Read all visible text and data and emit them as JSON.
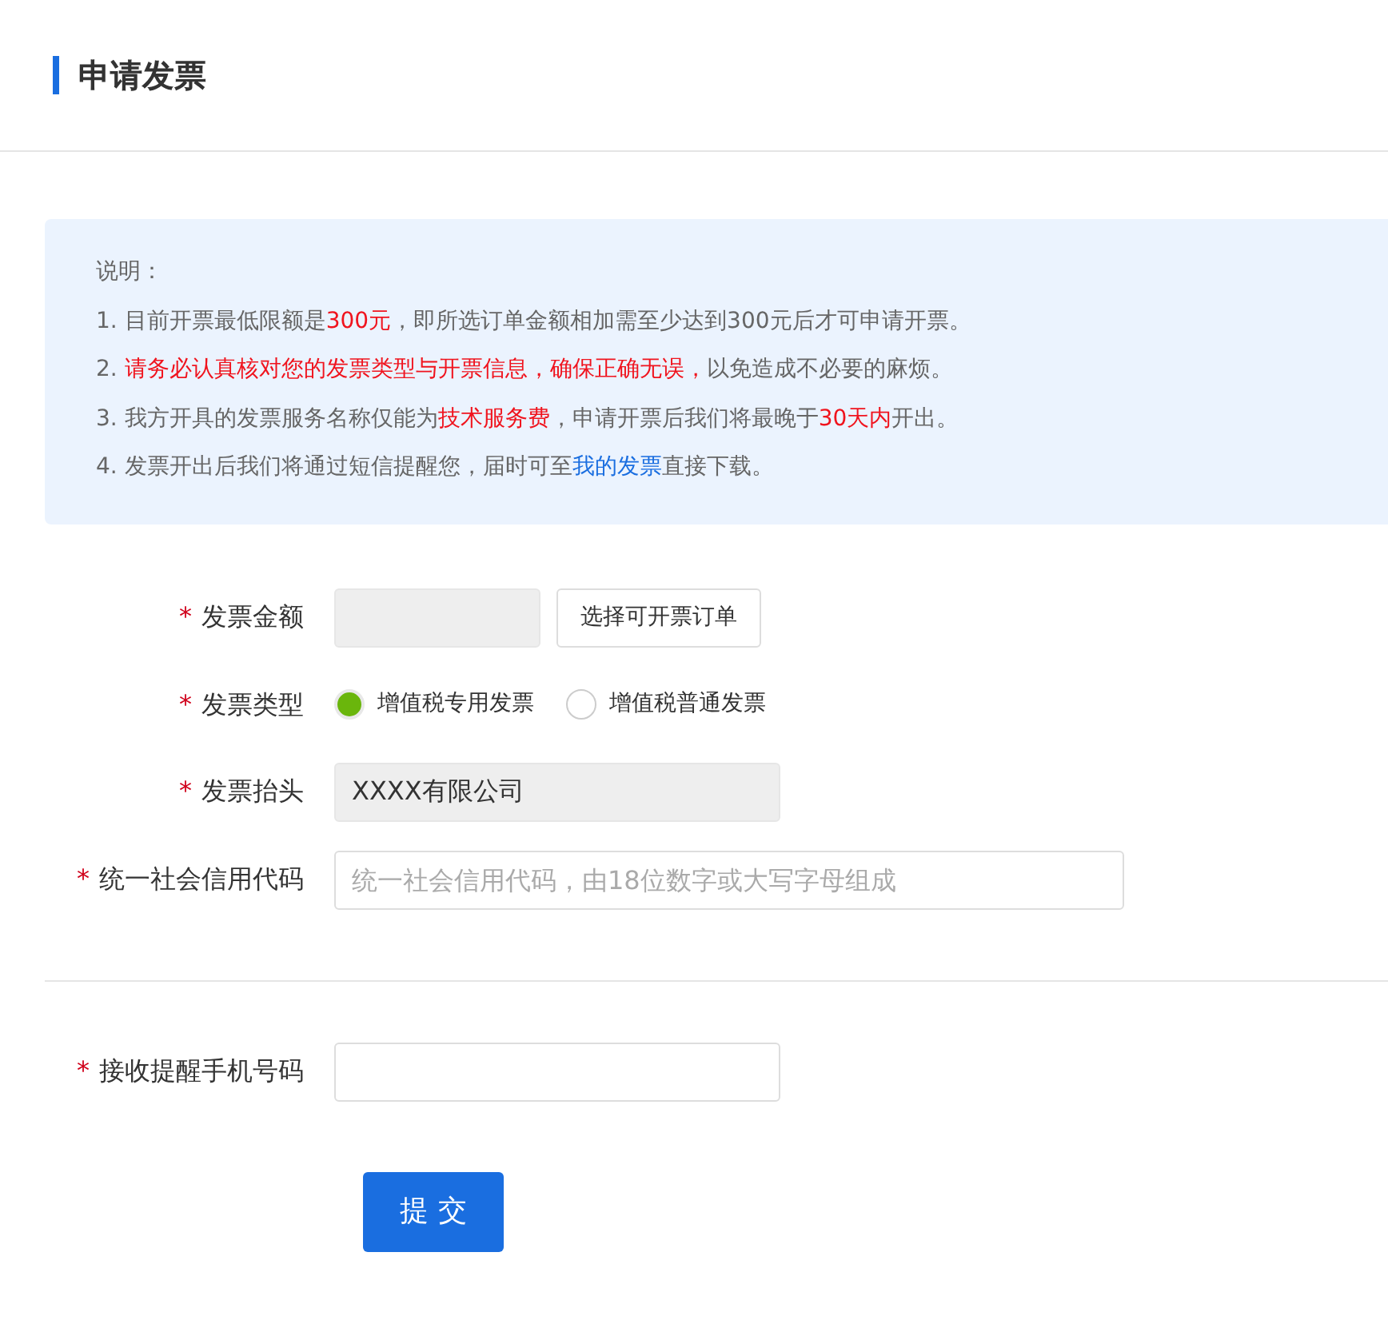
{
  "page": {
    "title": "申请发票"
  },
  "notice": {
    "heading": "说明：",
    "items": [
      [
        {
          "kind": "plain",
          "text": "1. 目前开票最低限额是"
        },
        {
          "kind": "red",
          "text": "300元"
        },
        {
          "kind": "plain",
          "text": "，即所选订单金额相加需至少达到300元后才可申请开票。"
        }
      ],
      [
        {
          "kind": "plain",
          "text": "2. "
        },
        {
          "kind": "red",
          "text": "请务必认真核对您的发票类型与开票信息，确保正确无误，"
        },
        {
          "kind": "plain",
          "text": "以免造成不必要的麻烦。"
        }
      ],
      [
        {
          "kind": "plain",
          "text": "3. 我方开具的发票服务名称仅能为"
        },
        {
          "kind": "red",
          "text": "技术服务费"
        },
        {
          "kind": "plain",
          "text": "，申请开票后我们将最晚于"
        },
        {
          "kind": "red",
          "text": "30天内"
        },
        {
          "kind": "plain",
          "text": "开出。"
        }
      ],
      [
        {
          "kind": "plain",
          "text": "4. 发票开出后我们将通过短信提醒您，届时可至"
        },
        {
          "kind": "link",
          "text": "我的发票"
        },
        {
          "kind": "plain",
          "text": "直接下载。"
        }
      ]
    ]
  },
  "form": {
    "sections": [
      [
        {
          "kind": "amount",
          "label": "发票金额",
          "required_mark": "*",
          "button": "选择可开票订单"
        },
        {
          "kind": "radio",
          "label": "发票类型",
          "required_mark": "*",
          "options": [
            {
              "label": "增值税专用发票",
              "selected": true
            },
            {
              "label": "增值税普通发票",
              "selected": false
            }
          ]
        },
        {
          "kind": "readonly",
          "label": "发票抬头",
          "required_mark": "*",
          "value": "XXXX有限公司"
        },
        {
          "kind": "text",
          "label": "统一社会信用代码",
          "required_mark": "*",
          "placeholder": "统一社会信用代码，由18位数字或大写字母组成",
          "wide": true
        }
      ],
      [
        {
          "kind": "text",
          "label": "接收提醒手机号码",
          "required_mark": "*"
        }
      ]
    ],
    "submit": "提 交"
  }
}
